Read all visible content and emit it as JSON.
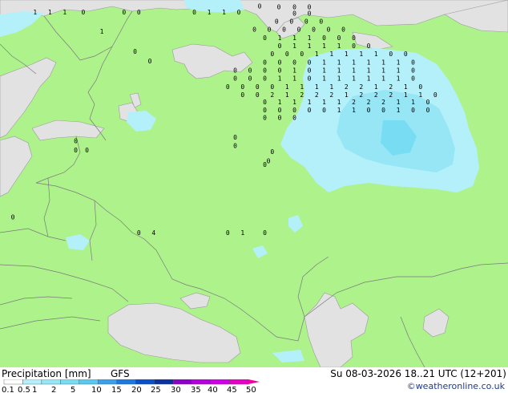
{
  "header": {
    "title": "Precipitation [mm]",
    "model": "GFS",
    "valid": "Su 08-03-2026 18..21 UTC (12+201)",
    "credit": "©weatheronline.co.uk"
  },
  "legend": {
    "labels": [
      "0.1",
      "0.5",
      "1",
      "2",
      "5",
      "10",
      "15",
      "20",
      "25",
      "30",
      "35",
      "40",
      "45",
      "50"
    ],
    "colors": [
      "#ffffff",
      "#b4f0fa",
      "#96e6f6",
      "#78dcf2",
      "#5ac8ee",
      "#3ca0e8",
      "#1e78e0",
      "#0a50c8",
      "#0a32a0",
      "#8c00c8",
      "#b400dc",
      "#d200e6",
      "#e600c8",
      "#f000a0"
    ]
  },
  "colors": {
    "land": "#aef28c",
    "sea": "#e2e2e2",
    "precip_light": "#b4f0fa",
    "precip_medium": "#96e6f6",
    "border": "#7a7a7a"
  },
  "values": [
    {
      "v": "0",
      "lat": 69.3,
      "lon": 45.3
    },
    {
      "v": "0",
      "lat": 69.2,
      "lon": 47.9
    },
    {
      "v": "0",
      "lat": 69.2,
      "lon": 50.0
    },
    {
      "v": "0",
      "lat": 69.2,
      "lon": 52.0
    },
    {
      "v": "0",
      "lat": 68.5,
      "lon": 50.0
    },
    {
      "v": "0",
      "lat": 68.5,
      "lon": 52.0
    },
    {
      "v": "1",
      "lat": 68.6,
      "lon": 15.0
    },
    {
      "v": "1",
      "lat": 68.6,
      "lon": 17.0
    },
    {
      "v": "1",
      "lat": 68.6,
      "lon": 19.0
    },
    {
      "v": "0",
      "lat": 68.6,
      "lon": 21.5
    },
    {
      "v": "0",
      "lat": 68.6,
      "lon": 27.0
    },
    {
      "v": "0",
      "lat": 68.6,
      "lon": 29.0
    },
    {
      "v": "0",
      "lat": 68.6,
      "lon": 36.5
    },
    {
      "v": "1",
      "lat": 68.6,
      "lon": 38.5
    },
    {
      "v": "1",
      "lat": 68.6,
      "lon": 40.5
    },
    {
      "v": "0",
      "lat": 68.6,
      "lon": 42.5
    },
    {
      "v": "0",
      "lat": 67.6,
      "lon": 47.6
    },
    {
      "v": "0",
      "lat": 67.6,
      "lon": 49.6
    },
    {
      "v": "0",
      "lat": 67.6,
      "lon": 51.6
    },
    {
      "v": "0",
      "lat": 67.6,
      "lon": 53.6
    },
    {
      "v": "0",
      "lat": 66.7,
      "lon": 44.6
    },
    {
      "v": "0",
      "lat": 66.7,
      "lon": 46.6
    },
    {
      "v": "0",
      "lat": 66.7,
      "lon": 48.6
    },
    {
      "v": "0",
      "lat": 66.7,
      "lon": 50.6
    },
    {
      "v": "0",
      "lat": 66.7,
      "lon": 52.6
    },
    {
      "v": "0",
      "lat": 66.7,
      "lon": 54.6
    },
    {
      "v": "0",
      "lat": 66.7,
      "lon": 56.6
    },
    {
      "v": "0",
      "lat": 65.8,
      "lon": 46.0
    },
    {
      "v": "1",
      "lat": 65.8,
      "lon": 48.0
    },
    {
      "v": "1",
      "lat": 65.8,
      "lon": 50.0
    },
    {
      "v": "1",
      "lat": 65.8,
      "lon": 52.0
    },
    {
      "v": "0",
      "lat": 65.8,
      "lon": 54.0
    },
    {
      "v": "0",
      "lat": 65.8,
      "lon": 56.0
    },
    {
      "v": "0",
      "lat": 65.8,
      "lon": 58.0
    },
    {
      "v": "0",
      "lat": 64.9,
      "lon": 48.0
    },
    {
      "v": "1",
      "lat": 64.9,
      "lon": 50.0
    },
    {
      "v": "1",
      "lat": 64.9,
      "lon": 52.0
    },
    {
      "v": "1",
      "lat": 64.9,
      "lon": 54.0
    },
    {
      "v": "1",
      "lat": 64.9,
      "lon": 56.0
    },
    {
      "v": "0",
      "lat": 64.9,
      "lon": 58.0
    },
    {
      "v": "0",
      "lat": 64.9,
      "lon": 60.0
    },
    {
      "v": "0",
      "lat": 64.0,
      "lon": 47.0
    },
    {
      "v": "0",
      "lat": 64.0,
      "lon": 49.0
    },
    {
      "v": "0",
      "lat": 64.0,
      "lon": 51.0
    },
    {
      "v": "1",
      "lat": 64.0,
      "lon": 53.0
    },
    {
      "v": "1",
      "lat": 64.0,
      "lon": 55.0
    },
    {
      "v": "1",
      "lat": 64.0,
      "lon": 57.0
    },
    {
      "v": "1",
      "lat": 64.0,
      "lon": 59.0
    },
    {
      "v": "1",
      "lat": 64.0,
      "lon": 61.0
    },
    {
      "v": "0",
      "lat": 64.0,
      "lon": 63.0
    },
    {
      "v": "0",
      "lat": 64.0,
      "lon": 65.0
    },
    {
      "v": "0",
      "lat": 63.1,
      "lon": 46.0
    },
    {
      "v": "0",
      "lat": 63.1,
      "lon": 48.0
    },
    {
      "v": "0",
      "lat": 63.1,
      "lon": 50.0
    },
    {
      "v": "0",
      "lat": 63.1,
      "lon": 52.0
    },
    {
      "v": "1",
      "lat": 63.1,
      "lon": 54.0
    },
    {
      "v": "1",
      "lat": 63.1,
      "lon": 56.0
    },
    {
      "v": "1",
      "lat": 63.1,
      "lon": 58.0
    },
    {
      "v": "1",
      "lat": 63.1,
      "lon": 60.0
    },
    {
      "v": "1",
      "lat": 63.1,
      "lon": 62.0
    },
    {
      "v": "1",
      "lat": 63.1,
      "lon": 64.0
    },
    {
      "v": "0",
      "lat": 63.1,
      "lon": 66.0
    },
    {
      "v": "0",
      "lat": 62.2,
      "lon": 42.0
    },
    {
      "v": "0",
      "lat": 62.2,
      "lon": 44.0
    },
    {
      "v": "0",
      "lat": 62.2,
      "lon": 46.0
    },
    {
      "v": "0",
      "lat": 62.2,
      "lon": 48.0
    },
    {
      "v": "1",
      "lat": 62.2,
      "lon": 50.0
    },
    {
      "v": "0",
      "lat": 62.2,
      "lon": 52.0
    },
    {
      "v": "1",
      "lat": 62.2,
      "lon": 54.0
    },
    {
      "v": "1",
      "lat": 62.2,
      "lon": 56.0
    },
    {
      "v": "1",
      "lat": 62.2,
      "lon": 58.0
    },
    {
      "v": "1",
      "lat": 62.2,
      "lon": 60.0
    },
    {
      "v": "1",
      "lat": 62.2,
      "lon": 62.0
    },
    {
      "v": "1",
      "lat": 62.2,
      "lon": 64.0
    },
    {
      "v": "0",
      "lat": 62.2,
      "lon": 66.0
    },
    {
      "v": "0",
      "lat": 61.3,
      "lon": 42.0
    },
    {
      "v": "0",
      "lat": 61.3,
      "lon": 44.0
    },
    {
      "v": "0",
      "lat": 61.3,
      "lon": 46.0
    },
    {
      "v": "1",
      "lat": 61.3,
      "lon": 48.0
    },
    {
      "v": "1",
      "lat": 61.3,
      "lon": 50.0
    },
    {
      "v": "0",
      "lat": 61.3,
      "lon": 52.0
    },
    {
      "v": "1",
      "lat": 61.3,
      "lon": 54.0
    },
    {
      "v": "1",
      "lat": 61.3,
      "lon": 56.0
    },
    {
      "v": "1",
      "lat": 61.3,
      "lon": 58.0
    },
    {
      "v": "1",
      "lat": 61.3,
      "lon": 60.0
    },
    {
      "v": "1",
      "lat": 61.3,
      "lon": 62.0
    },
    {
      "v": "1",
      "lat": 61.3,
      "lon": 64.0
    },
    {
      "v": "0",
      "lat": 61.3,
      "lon": 66.0
    },
    {
      "v": "0",
      "lat": 60.4,
      "lon": 41.0
    },
    {
      "v": "0",
      "lat": 60.4,
      "lon": 43.0
    },
    {
      "v": "0",
      "lat": 60.4,
      "lon": 45.0
    },
    {
      "v": "0",
      "lat": 60.4,
      "lon": 47.0
    },
    {
      "v": "1",
      "lat": 60.4,
      "lon": 49.0
    },
    {
      "v": "1",
      "lat": 60.4,
      "lon": 51.0
    },
    {
      "v": "1",
      "lat": 60.4,
      "lon": 53.0
    },
    {
      "v": "1",
      "lat": 60.4,
      "lon": 55.0
    },
    {
      "v": "2",
      "lat": 60.4,
      "lon": 57.0
    },
    {
      "v": "2",
      "lat": 60.4,
      "lon": 59.0
    },
    {
      "v": "1",
      "lat": 60.4,
      "lon": 61.0
    },
    {
      "v": "2",
      "lat": 60.4,
      "lon": 63.0
    },
    {
      "v": "1",
      "lat": 60.4,
      "lon": 65.0
    },
    {
      "v": "0",
      "lat": 60.4,
      "lon": 67.0
    },
    {
      "v": "0",
      "lat": 59.5,
      "lon": 43.0
    },
    {
      "v": "0",
      "lat": 59.5,
      "lon": 45.0
    },
    {
      "v": "2",
      "lat": 59.5,
      "lon": 47.0
    },
    {
      "v": "1",
      "lat": 59.5,
      "lon": 49.0
    },
    {
      "v": "2",
      "lat": 59.5,
      "lon": 51.0
    },
    {
      "v": "2",
      "lat": 59.5,
      "lon": 53.0
    },
    {
      "v": "2",
      "lat": 59.5,
      "lon": 55.0
    },
    {
      "v": "1",
      "lat": 59.5,
      "lon": 57.0
    },
    {
      "v": "2",
      "lat": 59.5,
      "lon": 59.0
    },
    {
      "v": "2",
      "lat": 59.5,
      "lon": 61.0
    },
    {
      "v": "2",
      "lat": 59.5,
      "lon": 63.0
    },
    {
      "v": "1",
      "lat": 59.5,
      "lon": 65.0
    },
    {
      "v": "1",
      "lat": 59.5,
      "lon": 67.0
    },
    {
      "v": "0",
      "lat": 59.5,
      "lon": 69.0
    },
    {
      "v": "0",
      "lat": 58.7,
      "lon": 46.0
    },
    {
      "v": "1",
      "lat": 58.7,
      "lon": 48.0
    },
    {
      "v": "1",
      "lat": 58.7,
      "lon": 50.0
    },
    {
      "v": "1",
      "lat": 58.7,
      "lon": 52.0
    },
    {
      "v": "1",
      "lat": 58.7,
      "lon": 54.0
    },
    {
      "v": "1",
      "lat": 58.7,
      "lon": 56.0
    },
    {
      "v": "2",
      "lat": 58.7,
      "lon": 58.0
    },
    {
      "v": "2",
      "lat": 58.7,
      "lon": 60.0
    },
    {
      "v": "2",
      "lat": 58.7,
      "lon": 62.0
    },
    {
      "v": "1",
      "lat": 58.7,
      "lon": 64.0
    },
    {
      "v": "1",
      "lat": 58.7,
      "lon": 66.0
    },
    {
      "v": "0",
      "lat": 58.7,
      "lon": 68.0
    },
    {
      "v": "0",
      "lat": 57.8,
      "lon": 46.0
    },
    {
      "v": "0",
      "lat": 57.8,
      "lon": 48.0
    },
    {
      "v": "0",
      "lat": 57.8,
      "lon": 50.0
    },
    {
      "v": "0",
      "lat": 57.8,
      "lon": 52.0
    },
    {
      "v": "0",
      "lat": 57.8,
      "lon": 54.0
    },
    {
      "v": "1",
      "lat": 57.8,
      "lon": 56.0
    },
    {
      "v": "1",
      "lat": 57.8,
      "lon": 58.0
    },
    {
      "v": "0",
      "lat": 57.8,
      "lon": 60.0
    },
    {
      "v": "0",
      "lat": 57.8,
      "lon": 62.0
    },
    {
      "v": "1",
      "lat": 57.8,
      "lon": 64.0
    },
    {
      "v": "0",
      "lat": 57.8,
      "lon": 66.0
    },
    {
      "v": "0",
      "lat": 57.8,
      "lon": 68.0
    },
    {
      "v": "0",
      "lat": 57.0,
      "lon": 46.0
    },
    {
      "v": "0",
      "lat": 57.0,
      "lon": 48.0
    },
    {
      "v": "0",
      "lat": 57.0,
      "lon": 50.0
    },
    {
      "v": "1",
      "lat": 66.5,
      "lon": 24.0
    },
    {
      "v": "0",
      "lat": 64.3,
      "lon": 28.5
    },
    {
      "v": "0",
      "lat": 63.2,
      "lon": 30.5
    },
    {
      "v": "0",
      "lat": 54.8,
      "lon": 42.0
    },
    {
      "v": "0",
      "lat": 53.9,
      "lon": 42.0
    },
    {
      "v": "0",
      "lat": 53.2,
      "lon": 47.0
    },
    {
      "v": "0",
      "lat": 52.2,
      "lon": 46.5
    },
    {
      "v": "0",
      "lat": 51.8,
      "lon": 46.0
    },
    {
      "v": "0",
      "lat": 54.4,
      "lon": 20.5
    },
    {
      "v": "0",
      "lat": 53.4,
      "lon": 20.5
    },
    {
      "v": "0",
      "lat": 53.4,
      "lon": 22.0
    },
    {
      "v": "0",
      "lat": 44.3,
      "lon": 41.0
    },
    {
      "v": "1",
      "lat": 44.3,
      "lon": 43.0
    },
    {
      "v": "0",
      "lat": 44.3,
      "lon": 46.0
    },
    {
      "v": "0",
      "lat": 46.0,
      "lon": 12.0
    },
    {
      "v": "0",
      "lat": 44.3,
      "lon": 29.0
    },
    {
      "v": "4",
      "lat": 44.3,
      "lon": 31.0
    }
  ]
}
